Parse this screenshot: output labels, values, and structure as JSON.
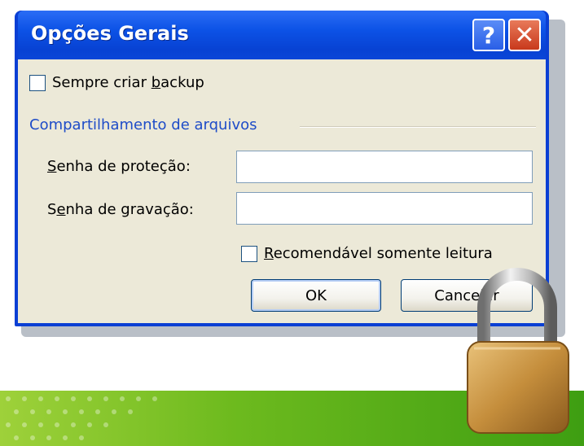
{
  "dialog": {
    "title": "Opções Gerais",
    "help_glyph": "?",
    "close_glyph": "✕"
  },
  "backup": {
    "label_before": "Sempre criar ",
    "label_mnemonic": "b",
    "label_after": "ackup",
    "checked": false
  },
  "sharing": {
    "group_label": "Compartilhamento de arquivos",
    "protect_label_mnemonic": "S",
    "protect_label_rest": "enha de proteção:",
    "protect_value": "",
    "write_label_first": "S",
    "write_label_mnemonic": "e",
    "write_label_rest": "nha de gravação:",
    "write_value": "",
    "readonly_mnemonic": "R",
    "readonly_rest": "ecomendável somente leitura",
    "readonly_checked": false
  },
  "buttons": {
    "ok_label": "OK",
    "cancel_label": "Cancelar"
  },
  "icons": [
    "help-icon",
    "close-icon",
    "padlock-icon"
  ],
  "colors": {
    "titlebar": "#0a46d8",
    "client": "#ece9d8",
    "group_label": "#1e4cc8",
    "banner": "#6dba1e"
  }
}
